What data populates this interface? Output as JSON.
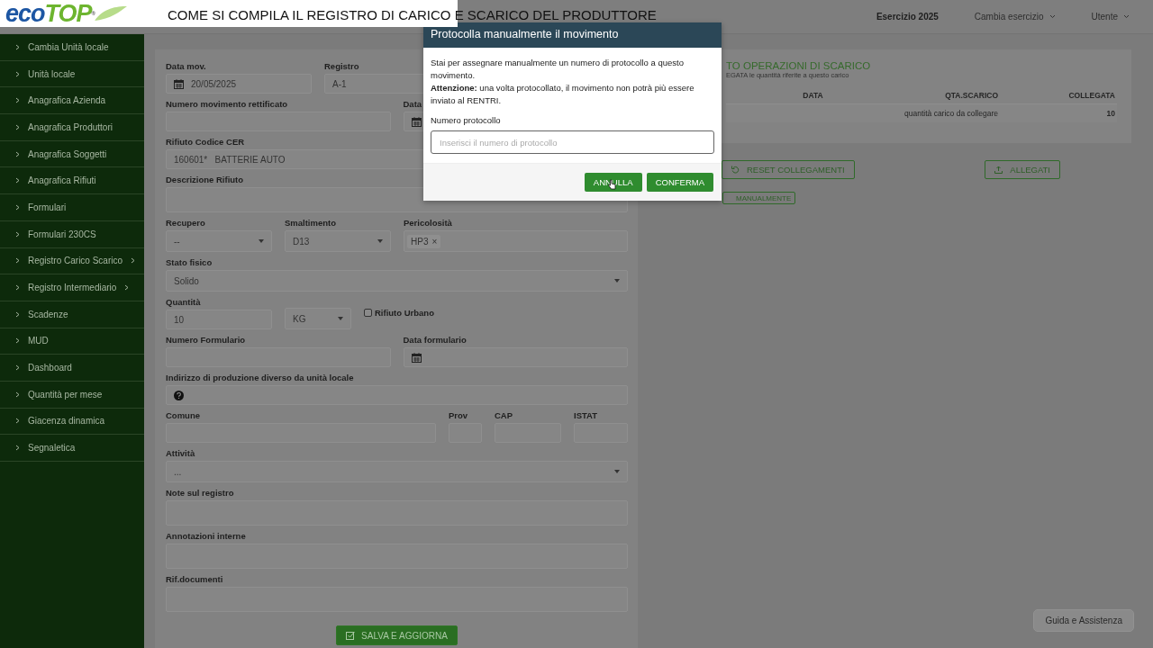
{
  "banner": {
    "logo": {
      "first": "eco",
      "second": "TOP",
      "mark": "®"
    },
    "title": "COME SI COMPILA IL REGISTRO DI CARICO E SCARICO DEL PRODUTTORE"
  },
  "header": {
    "year": "Esercizio 2025",
    "menus": [
      {
        "label": "Cambia esercizio"
      },
      {
        "label": "Utente"
      }
    ]
  },
  "sidebar": {
    "items": [
      {
        "label": "Cambia Unità locale",
        "has_submenu": false
      },
      {
        "label": "Unità locale",
        "has_submenu": false
      },
      {
        "label": "Anagrafica Azienda",
        "has_submenu": false
      },
      {
        "label": "Anagrafica Produttori",
        "has_submenu": false
      },
      {
        "label": "Anagrafica Soggetti",
        "has_submenu": false
      },
      {
        "label": "Anagrafica Rifiuti",
        "has_submenu": false
      },
      {
        "label": "Formulari",
        "has_submenu": false
      },
      {
        "label": "Formulari 230CS",
        "has_submenu": false
      },
      {
        "label": "Registro Carico Scarico",
        "has_submenu": true
      },
      {
        "label": "Registro Intermediario",
        "has_submenu": true
      },
      {
        "label": "Scadenze",
        "has_submenu": false
      },
      {
        "label": "MUD",
        "has_submenu": false
      },
      {
        "label": "Dashboard",
        "has_submenu": false
      },
      {
        "label": "Quantità per mese",
        "has_submenu": false
      },
      {
        "label": "Giacenza dinamica",
        "has_submenu": false
      },
      {
        "label": "Segnaletica",
        "has_submenu": false
      }
    ]
  },
  "form": {
    "rows": [
      [
        {
          "kind": "date",
          "label": "Data mov.",
          "value": "20/05/2025"
        },
        {
          "kind": "input",
          "label": "Registro",
          "value": "A-1"
        }
      ],
      [
        {
          "kind": "input",
          "label": "Numero movimento rettificato"
        },
        {
          "kind": "date",
          "label": "Data"
        }
      ],
      [
        {
          "kind": "input",
          "label": "Rifiuto Codice CER",
          "value": "160601*   BATTERIE AUTO"
        }
      ],
      [
        {
          "kind": "textarea",
          "label": "Descrizione Rifiuto"
        }
      ],
      [
        {
          "kind": "select",
          "label": "Recupero",
          "value": "--"
        },
        {
          "kind": "select",
          "label": "Smaltimento",
          "value": "D13"
        },
        {
          "kind": "tags",
          "label": "Pericolosità",
          "tags": [
            {
              "label": "HP3",
              "remove": "×"
            }
          ]
        }
      ],
      [
        {
          "kind": "select",
          "label": "Stato fisico",
          "value": "Solido"
        }
      ],
      [
        {
          "kind": "input",
          "label": "Quantità",
          "value": "10"
        },
        {
          "kind": "select",
          "value": "KG"
        },
        {
          "kind": "checkbox",
          "label": "Rifiuto Urbano",
          "checked": false
        }
      ],
      [
        {
          "kind": "input",
          "label": "Numero Formulario"
        },
        {
          "kind": "date",
          "label": "Data formulario"
        }
      ],
      [
        {
          "kind": "help",
          "label": "Indirizzo di produzione diverso da unità locale"
        }
      ],
      [
        {
          "kind": "input",
          "label": "Comune"
        },
        {
          "kind": "input",
          "label": "Prov"
        },
        {
          "kind": "input",
          "label": "CAP"
        },
        {
          "kind": "input",
          "label": "ISTAT"
        }
      ],
      [
        {
          "kind": "select",
          "label": "Attività",
          "value": "..."
        }
      ],
      [
        {
          "kind": "textarea",
          "label": "Note sul registro"
        }
      ],
      [
        {
          "kind": "textarea",
          "label": "Annotazioni interne"
        }
      ],
      [
        {
          "kind": "textarea",
          "label": "Rif.documenti"
        }
      ]
    ],
    "save_button": "SALVA E AGGIORNA"
  },
  "links_panel": {
    "title": "TO OPERAZIONI DI SCARICO",
    "subtitle": "EGATA le quantità riferite a questo carico",
    "columns": [
      "DATA",
      "QTA.SCARICO",
      "COLLEGATA"
    ],
    "rows": [
      {
        "qta": "quantità carico da collegare",
        "collegata": "10"
      }
    ],
    "buttons": [
      {
        "kind": "reset",
        "label": "RESET COLLEGAMENTI"
      },
      {
        "kind": "upload",
        "label": "ALLEGATI"
      }
    ],
    "manual_button": "MANUALMENTE"
  },
  "modal": {
    "title": "Protocolla manualmente il movimento",
    "message": [
      "Stai per assegnare manualmente un numero di protocollo a questo movimento.",
      "**Attenzione:** una volta protocollato, il movimento non potrà più essere inviato al RENTRI."
    ],
    "field": {
      "label": "Numero protocollo",
      "placeholder": "Inserisci il numero di protocollo"
    },
    "buttons": [
      {
        "label": "ANNULLA"
      },
      {
        "label": "CONFERMA"
      }
    ]
  },
  "help_button": "Guida e Assistenza"
}
